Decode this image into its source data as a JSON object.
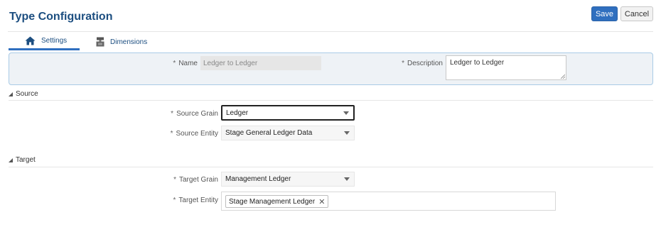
{
  "page": {
    "title": "Type Configuration"
  },
  "toolbar": {
    "save_label": "Save",
    "cancel_label": "Cancel"
  },
  "tabs": [
    {
      "label": "Settings",
      "icon": "home-icon",
      "active": true
    },
    {
      "label": "Dimensions",
      "icon": "dimensions-icon",
      "active": false
    }
  ],
  "general": {
    "required_marker": "*",
    "name": {
      "label": "Name",
      "value": "Ledger to Ledger"
    },
    "description": {
      "label": "Description",
      "value": "Ledger to Ledger"
    }
  },
  "source": {
    "header": "Source",
    "grain": {
      "label": "Source Grain",
      "value": "Ledger"
    },
    "entity": {
      "label": "Source Entity",
      "value": "Stage General Ledger Data"
    }
  },
  "target": {
    "header": "Target",
    "grain": {
      "label": "Target Grain",
      "value": "Management Ledger"
    },
    "entity": {
      "label": "Target Entity",
      "chips": [
        "Stage Management Ledger"
      ]
    }
  },
  "colors": {
    "accent": "#2f6fbf",
    "title": "#1c4e80",
    "panel_bg": "#eef2f6",
    "panel_border": "#a9cbe6"
  }
}
